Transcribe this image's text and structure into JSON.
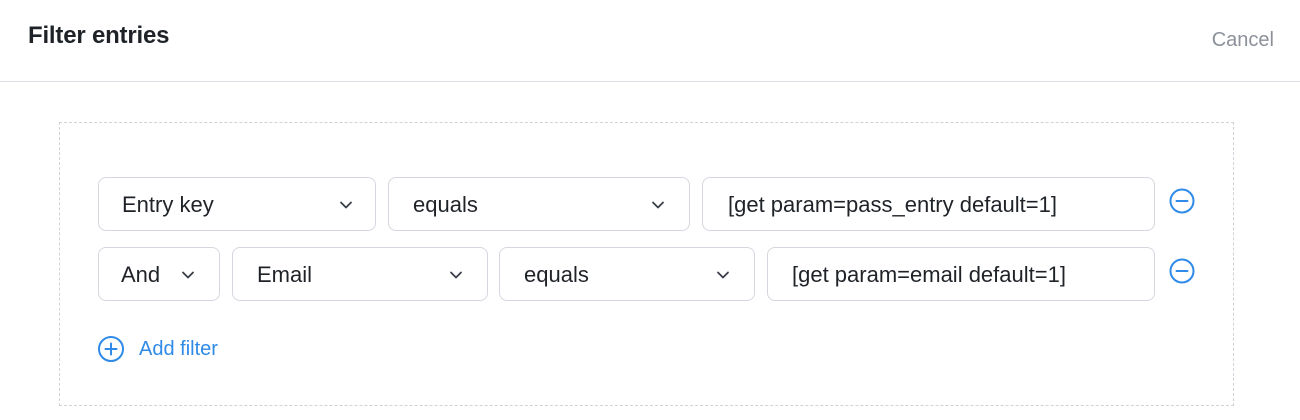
{
  "header": {
    "title": "Filter entries",
    "cancel_label": "Cancel"
  },
  "filters": {
    "rows": [
      {
        "field": "Entry key",
        "operator": "equals",
        "value": "[get param=pass_entry default=1]"
      },
      {
        "conjunction": "And",
        "field": "Email",
        "operator": "equals",
        "value": "[get param=email default=1]"
      }
    ],
    "add_label": "Add filter"
  },
  "colors": {
    "accent": "#2f8ae8",
    "border": "#d4d8de",
    "muted_text": "#8b9099"
  }
}
